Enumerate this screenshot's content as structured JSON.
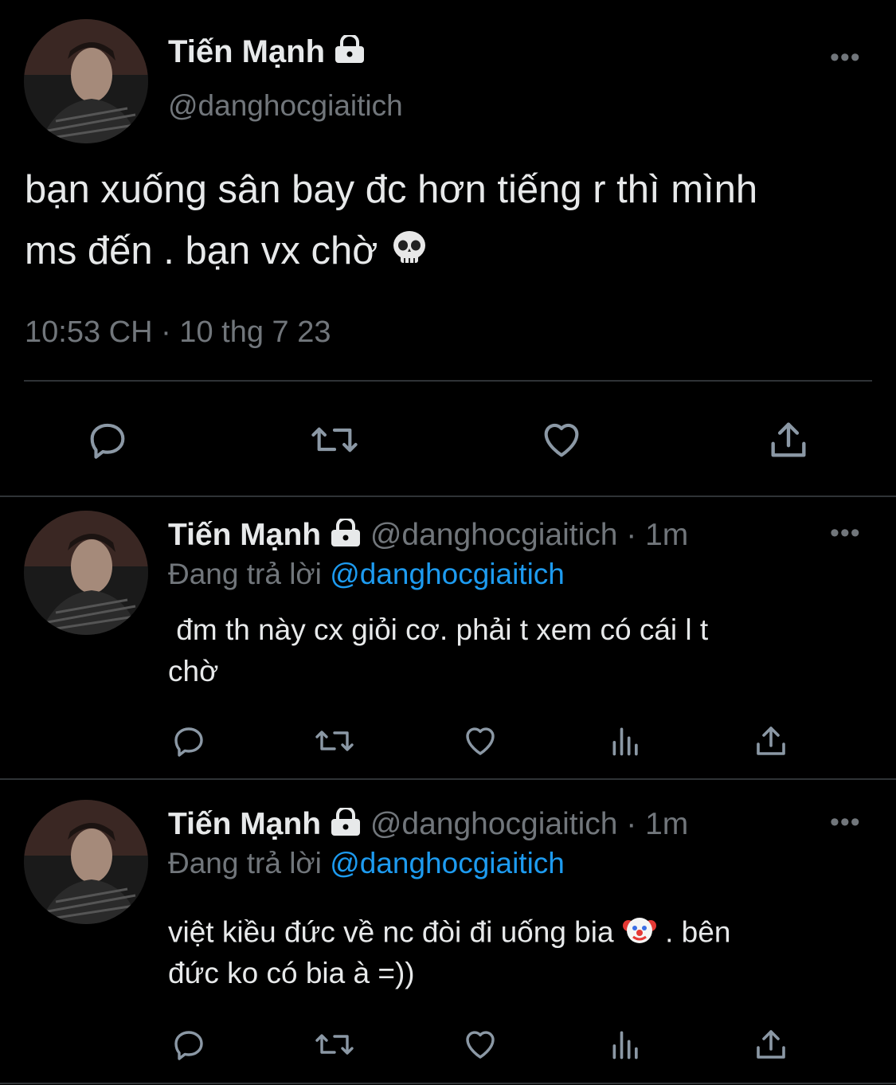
{
  "main_tweet": {
    "display_name": "Tiến Mạnh",
    "handle": "@danghocgiaitich",
    "text_line1": "bạn xuống sân bay đc hơn tiếng r thì mình",
    "text_line2": "ms đến . bạn vx chờ",
    "timestamp": "10:53 CH · 10 thg 7 23",
    "emoji": "skull",
    "actions": [
      "reply-icon",
      "retweet-icon",
      "like-icon",
      "share-icon"
    ]
  },
  "replies": [
    {
      "display_name": "Tiến Mạnh",
      "handle": "@danghocgiaitich",
      "time": "· 1m",
      "replying_label": "Đang trả lời",
      "replying_to": "@danghocgiaitich",
      "text_line1": " đm th này cx giỏi cơ. phải t xem có cái l t",
      "text_line2": "chờ",
      "actions": [
        "reply-icon",
        "retweet-icon",
        "like-icon",
        "views-icon",
        "share-icon"
      ]
    },
    {
      "display_name": "Tiến Mạnh",
      "handle": "@danghocgiaitich",
      "time": "· 1m",
      "replying_label": "Đang trả lời",
      "replying_to": "@danghocgiaitich",
      "text_line1_a": "việt kiều đức về nc đòi đi uống bia",
      "text_line1_b": " . bên",
      "text_line2": "đức ko có bia à =))",
      "emoji": "clown",
      "actions": [
        "reply-icon",
        "retweet-icon",
        "like-icon",
        "views-icon",
        "share-icon"
      ]
    }
  ],
  "colors": {
    "background": "#000000",
    "text": "#e7e9ea",
    "muted": "#71767b",
    "link": "#1d9bf0",
    "divider": "#2f3336"
  }
}
